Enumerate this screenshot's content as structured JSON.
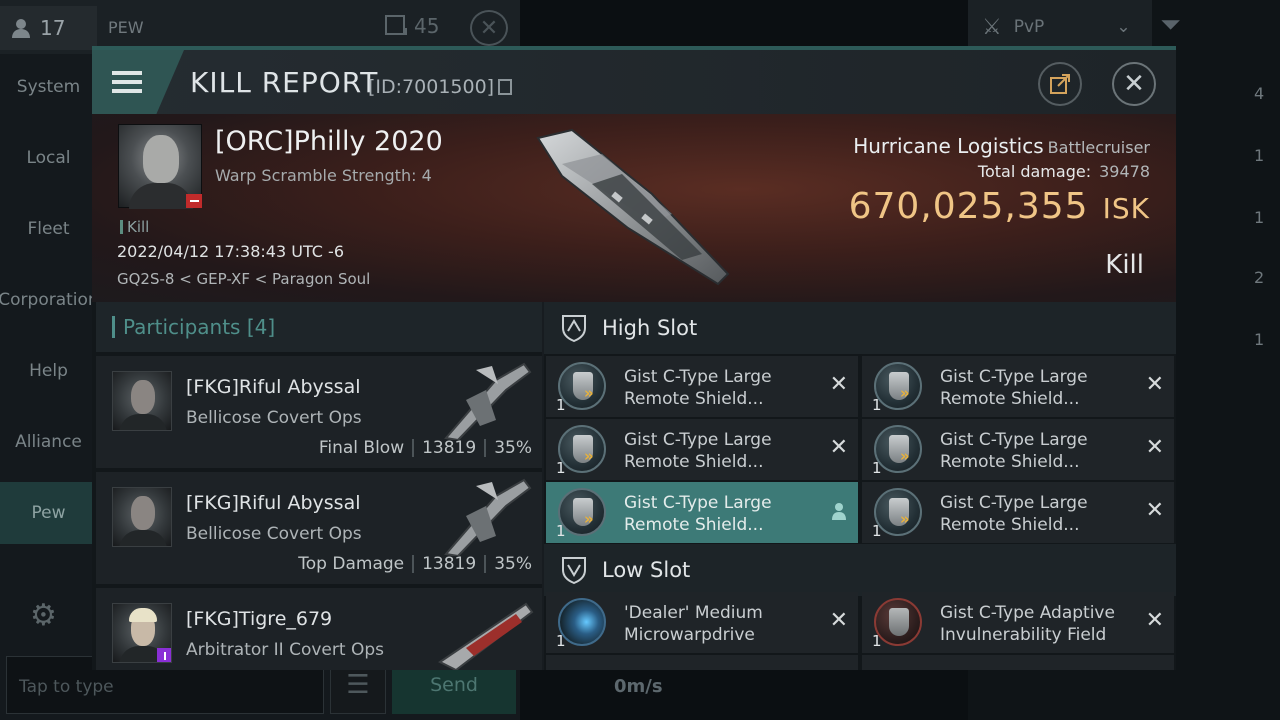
{
  "background": {
    "member_count": "17",
    "channel": "PEW",
    "channel_count": "45",
    "nav": [
      "System",
      "Local",
      "Fleet",
      "Corporation",
      "Help",
      "Alliance",
      "Pew"
    ],
    "active_nav": "Pew",
    "input_placeholder": "Tap to type",
    "send_label": "Send",
    "overview_tab": "PvP",
    "speed": "0m/s",
    "right_counts": [
      "4",
      "1",
      "1",
      "2",
      "1"
    ]
  },
  "header": {
    "title": "KILL REPORT",
    "id": "[ID:7001500]"
  },
  "victim": {
    "name": "[ORC]Philly 2020",
    "warp": "Warp Scramble Strength: 4",
    "tag": "Kill",
    "date": "2022/04/12 17:38:43 UTC -6",
    "location": "GQ2S-8 < GEP-XF < Paragon Soul",
    "ship_name": "Hurricane Logistics",
    "ship_class": "Battlecruiser",
    "damage_label": "Total damage:",
    "damage_value": "39478",
    "isk_value": "670,025,355",
    "isk_unit": "ISK",
    "result": "Kill"
  },
  "participants": {
    "label": "Participants",
    "count": "[4]",
    "items": [
      {
        "name": "[FKG]Riful Abyssal",
        "ship": "Bellicose Covert Ops",
        "role": "Final Blow",
        "damage": "13819",
        "percent": "35%"
      },
      {
        "name": "[FKG]Riful Abyssal",
        "ship": "Bellicose Covert Ops",
        "role": "Top Damage",
        "damage": "13819",
        "percent": "35%"
      },
      {
        "name": "[FKG]Tigre_679",
        "ship": "Arbitrator II Covert Ops",
        "role": "",
        "damage": "",
        "percent": ""
      }
    ]
  },
  "fitting": {
    "high_label": "High Slot",
    "low_label": "Low Slot",
    "high": [
      {
        "qty": "1",
        "name": "Gist C-Type Large Remote Shield..."
      },
      {
        "qty": "1",
        "name": "Gist C-Type Large Remote Shield..."
      },
      {
        "qty": "1",
        "name": "Gist C-Type Large Remote Shield..."
      },
      {
        "qty": "1",
        "name": "Gist C-Type Large Remote Shield..."
      },
      {
        "qty": "1",
        "name": "Gist C-Type Large Remote Shield..."
      },
      {
        "qty": "1",
        "name": "Gist C-Type Large Remote Shield..."
      }
    ],
    "low": [
      {
        "qty": "1",
        "name": "'Dealer' Medium Microwarpdrive"
      },
      {
        "qty": "1",
        "name": "Gist C-Type Adaptive Invulnerability Field"
      }
    ]
  }
}
